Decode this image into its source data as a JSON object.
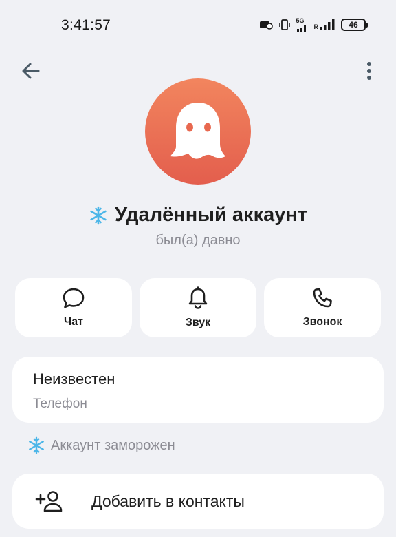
{
  "status_bar": {
    "time": "3:41:57",
    "network_label": "5G",
    "roaming_label": "R",
    "battery_level": "46"
  },
  "top_bar": {
    "back_icon": "arrow-left-icon",
    "menu_icon": "more-vertical-icon"
  },
  "profile": {
    "avatar_icon": "ghost-icon",
    "avatar_color": "#e8684f",
    "badge_icon": "snowflake-icon",
    "badge_color": "#4cb6e8",
    "name": "Удалённый аккаунт",
    "last_seen": "был(а) давно"
  },
  "actions": [
    {
      "label": "Чат",
      "icon": "chat-bubble-icon"
    },
    {
      "label": "Звук",
      "icon": "bell-icon"
    },
    {
      "label": "Звонок",
      "icon": "phone-icon"
    }
  ],
  "info": {
    "value": "Неизвестен",
    "label": "Телефон"
  },
  "frozen": {
    "icon": "snowflake-icon",
    "text": "Аккаунт заморожен"
  },
  "add_contact": {
    "icon": "add-person-icon",
    "label": "Добавить в контакты"
  }
}
